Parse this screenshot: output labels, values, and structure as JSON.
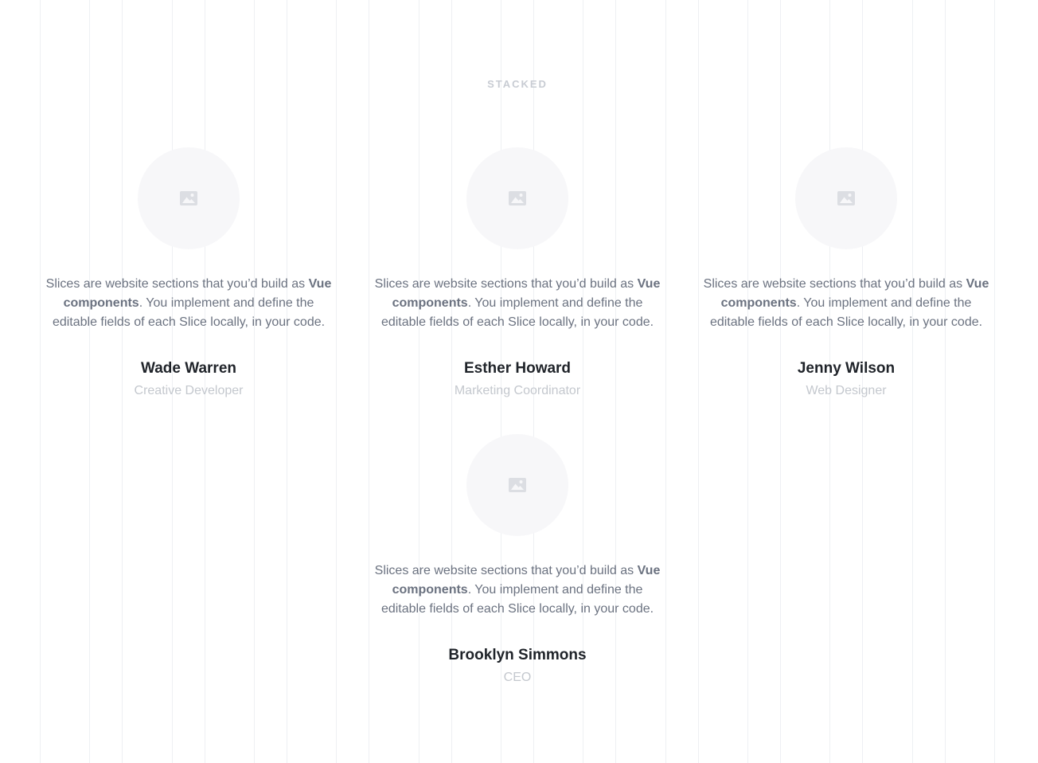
{
  "section": {
    "eyebrow": "STACKED"
  },
  "testimonials": [
    {
      "quote_before": "Slices are website sections that you’d build as ",
      "quote_bold": "Vue components",
      "quote_after": ". You implement and define the editable fields of each Slice locally, in your code.",
      "name": "Wade Warren",
      "role": "Creative Developer",
      "avatar_icon": "image-placeholder-icon"
    },
    {
      "quote_before": "Slices are website sections that you’d build as ",
      "quote_bold": "Vue components",
      "quote_after": ". You implement and define the editable fields of each Slice locally, in your code.",
      "name": "Esther Howard",
      "role": "Marketing Coordinator",
      "avatar_icon": "image-placeholder-icon"
    },
    {
      "quote_before": "Slices are website sections that you’d build as ",
      "quote_bold": "Vue components",
      "quote_after": ". You implement and define the editable fields of each Slice locally, in your code.",
      "name": "Jenny Wilson",
      "role": "Web Designer",
      "avatar_icon": "image-placeholder-icon"
    },
    {
      "quote_before": "Slices are website sections that you’d build as ",
      "quote_bold": "Vue components",
      "quote_after": ". You implement and define the editable fields of each Slice locally, in your code.",
      "name": "Brooklyn Simmons",
      "role": "CEO",
      "avatar_icon": "image-placeholder-icon"
    }
  ],
  "colors": {
    "background": "#ffffff",
    "grid_line": "#eef0f3",
    "avatar_bg": "#f7f7f9",
    "placeholder_icon": "#dcdee3",
    "text_body": "#6b7280",
    "text_name": "#1f2329",
    "text_muted": "#c4c8ce"
  }
}
